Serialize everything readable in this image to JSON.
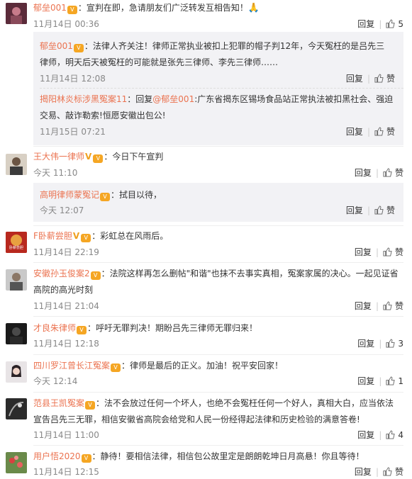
{
  "comments": [
    {
      "user": "郁垒001",
      "text": "：宣判在即，急请朋友们广泛转发互相告知！",
      "emoji": "folded-hands",
      "time": "11月14日 00:36",
      "reply": "回复",
      "like": "5"
    },
    {
      "user": "王大伟一律师",
      "text": "：今日下午宣判",
      "time": "今天 11:10",
      "reply": "回复",
      "like": "赞"
    },
    {
      "user": "F卧薪尝胆",
      "text": "：彩虹总在风雨后。",
      "time": "11月14日 22:19",
      "reply": "回复",
      "like": "赞"
    },
    {
      "user": "安徽孙玉俊案2",
      "text1": "：法院这样再怎么删帖\"和谐\"也抹不去事实真相，冤案家属的决心。一起见证省",
      "text2": "高院的高光时刻",
      "time": "11月14日 21:04",
      "reply": "回复",
      "like": "赞"
    },
    {
      "user": "才良朱律师",
      "text": "：呼吁无罪判决！期盼吕先三律师无罪归来！",
      "time": "11月14日 12:18",
      "reply": "回复",
      "like": "3"
    },
    {
      "user": "四川罗江曾长江冤案",
      "text": "：律师是最后的正义。加油！祝平安回家！",
      "time": "今天 12:14",
      "reply": "回复",
      "like": "1"
    },
    {
      "user": "范县王凯冤案",
      "text1": "：法不会放过任何一个坏人，也绝不会冤枉任何一个好人，真相大白，应当依法",
      "text2": "宣告吕先三无罪，相信安徽省高院会给党和人民一份经得起法律和历史检验的满意答卷!",
      "time": "11月14日 11:00",
      "reply": "回复",
      "like": "4"
    },
    {
      "user": "用户悟2020",
      "text": "：静待！要相信法律，相信包公故里定是朗朗乾坤日月高悬！你且等待！",
      "time": "11月14日 12:15",
      "reply": "回复",
      "like": "赞"
    }
  ],
  "replies": [
    {
      "user": "郁垒001",
      "text1": "：法律人齐关注！律师正常执业被扣上犯罪的帽子判12年，今天冤枉的是吕先三",
      "text2": "律师，明天后天被冤枉的可能就是张先三律师、李先三律师……",
      "time": "11月14日 12:08",
      "reply": "回复",
      "like": "赞"
    },
    {
      "user": "揭阳林炎标涉黑冤案11",
      "prefix": "：回复",
      "mention": "@郁垒001",
      "text1": ":广东省揭东区锡场食品站正常执法被扣黑社会、强迫",
      "text2": "交易、敲诈勒索!恒愿安徽出包公!",
      "time": "11月15日 07:21",
      "reply": "回复",
      "like": "赞"
    },
    {
      "user": "高明律师蒙冤记",
      "text": "：拭目以待，",
      "time": "今天 12:07",
      "reply": "回复",
      "like": "赞"
    }
  ],
  "avatar_label": "卧薪尝胆"
}
